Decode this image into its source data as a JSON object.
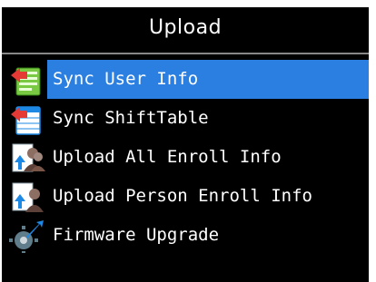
{
  "header": {
    "title": "Upload"
  },
  "menu": {
    "selected_index": 0,
    "items": [
      {
        "label": "Sync User Info",
        "icon": "sync-user-icon"
      },
      {
        "label": "Sync ShiftTable",
        "icon": "sync-shift-table-icon"
      },
      {
        "label": "Upload All Enroll Info",
        "icon": "upload-all-users-icon"
      },
      {
        "label": "Upload Person Enroll Info",
        "icon": "upload-person-icon"
      },
      {
        "label": "Firmware Upgrade",
        "icon": "firmware-upgrade-icon"
      }
    ]
  },
  "colors": {
    "background": "#000000",
    "text": "#ffffff",
    "selection": "#2a7fe0"
  }
}
